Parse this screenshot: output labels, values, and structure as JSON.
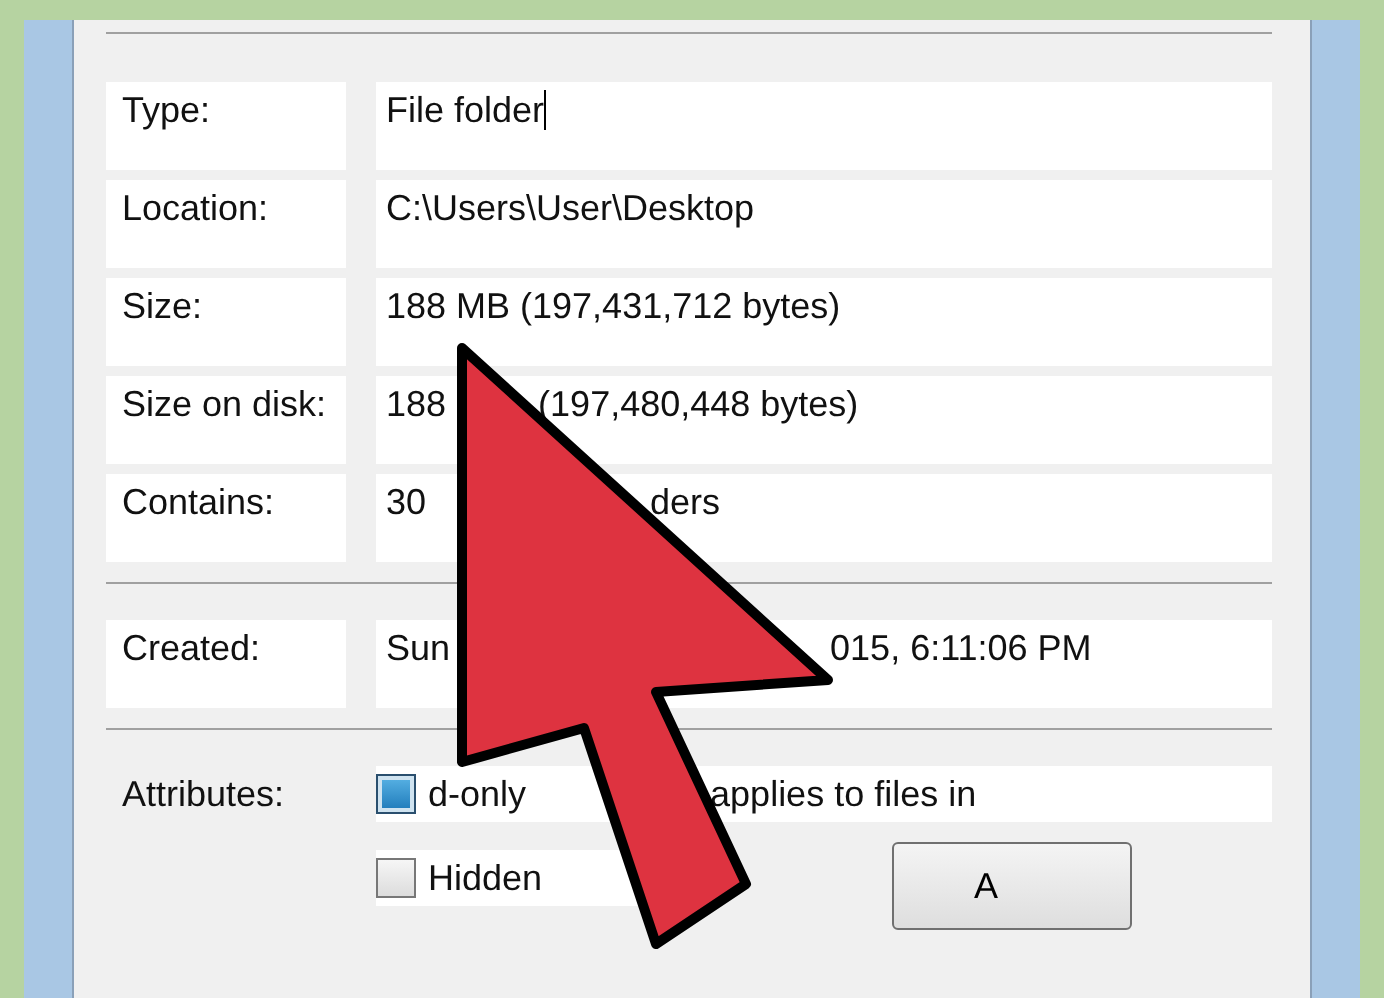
{
  "sections": [
    {
      "rows": [
        {
          "label": "Type:",
          "parts": [
            "File folder"
          ],
          "cursor": true
        },
        {
          "label": "Location:",
          "parts": [
            "C:\\Users\\User\\Desktop"
          ]
        },
        {
          "label": "Size:",
          "parts": [
            "188 MB (197,431,712 bytes)"
          ]
        },
        {
          "label": "Size on disk:",
          "parts": [
            "188",
            "(197,480,448 bytes)"
          ]
        },
        {
          "label": "Contains:",
          "parts": [
            "30",
            "ders"
          ]
        }
      ]
    },
    {
      "rows": [
        {
          "label": "Created:",
          "parts": [
            "Sun",
            "015, 6:11:06 PM"
          ]
        }
      ]
    }
  ],
  "attributes": {
    "label": "Attributes:",
    "checkboxes": [
      {
        "parts": [
          "d-only",
          "applies to files in"
        ],
        "checked": true
      },
      {
        "parts": [
          "Hidden"
        ],
        "checked": false
      }
    ],
    "button": "A"
  }
}
